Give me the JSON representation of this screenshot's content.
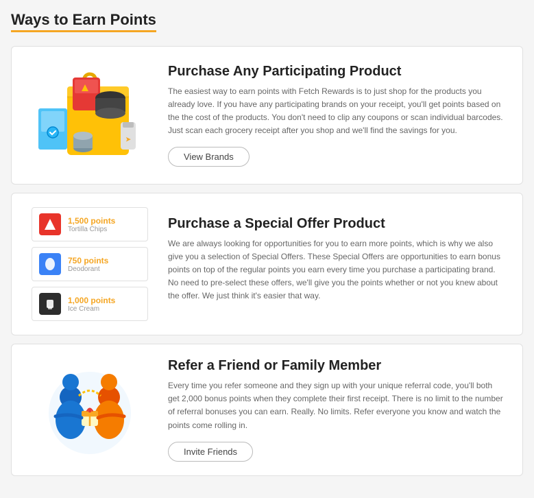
{
  "page": {
    "title": "Ways to Earn Points"
  },
  "sections": [
    {
      "id": "participating-product",
      "title": "Purchase Any Participating Product",
      "description": "The easiest way to earn points with Fetch Rewards is to just shop for the products you already love. If you have any participating brands on your receipt, you'll get points based on the the cost of the products. You don't need to clip any coupons or scan individual barcodes. Just scan each grocery receipt after you shop and we'll find the savings for you.",
      "button_label": "View Brands"
    },
    {
      "id": "special-offer",
      "title": "Purchase a Special Offer Product",
      "description": "We are always looking for opportunities for you to earn more points, which is why we also give you a selection of Special Offers. These Special Offers are opportunities to earn bonus points on top of the regular points you earn every time you purchase a participating brand. No need to pre-select these offers, we'll give you the points whether or not you knew about the offer. We just think it's easier that way.",
      "button_label": null,
      "offers": [
        {
          "points": "1,500 points",
          "product": "Tortilla Chips",
          "color": "red"
        },
        {
          "points": "750 points",
          "product": "Deodorant",
          "color": "blue"
        },
        {
          "points": "1,000 points",
          "product": "Ice Cream",
          "color": "dark"
        }
      ]
    },
    {
      "id": "refer-friend",
      "title": "Refer a Friend or Family Member",
      "description": "Every time you refer someone and they sign up with your unique referral code, you'll both get 2,000 bonus points when they complete their first receipt. There is no limit to the number of referral bonuses you can earn. Really. No limits. Refer everyone you know and watch the points come rolling in.",
      "button_label": "Invite Friends"
    }
  ]
}
